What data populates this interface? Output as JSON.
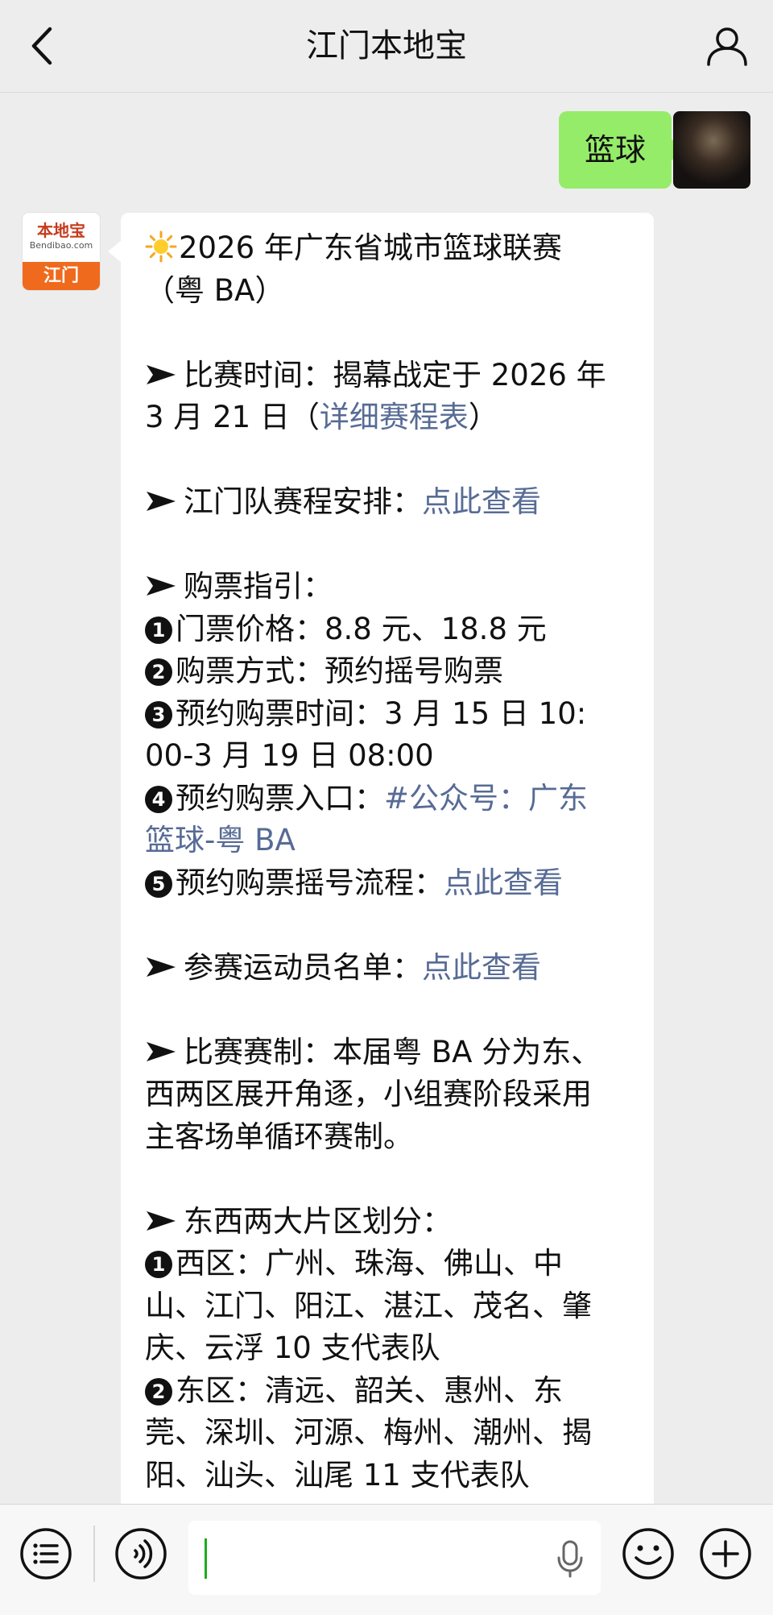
{
  "header": {
    "title": "江门本地宝"
  },
  "chat": {
    "outgoing_text": "篮球",
    "bot_avatar": {
      "brand": "本地宝",
      "site": "Bendibao.com",
      "city": "江门"
    }
  },
  "article": {
    "lines": [
      {
        "type": "text",
        "icon": "sun",
        "segments": [
          {
            "text": "2026 年广东省城市篮球联赛"
          }
        ]
      },
      {
        "type": "text",
        "segments": [
          {
            "text": "（粤 BA）"
          }
        ]
      },
      {
        "type": "blank"
      },
      {
        "type": "text",
        "icon": "arrow",
        "segments": [
          {
            "text": "比赛时间：揭幕战定于 2026 年"
          }
        ]
      },
      {
        "type": "text",
        "segments": [
          {
            "text": "3 月 21 日（"
          },
          {
            "text": "详细赛程表",
            "link": true
          },
          {
            "text": "）"
          }
        ]
      },
      {
        "type": "blank"
      },
      {
        "type": "text",
        "icon": "arrow",
        "segments": [
          {
            "text": "江门队赛程安排："
          },
          {
            "text": "点此查看",
            "link": true
          }
        ]
      },
      {
        "type": "blank"
      },
      {
        "type": "text",
        "icon": "arrow",
        "segments": [
          {
            "text": "购票指引："
          }
        ]
      },
      {
        "type": "text",
        "num": "1",
        "segments": [
          {
            "text": "门票价格：8.8 元、18.8 元"
          }
        ]
      },
      {
        "type": "text",
        "num": "2",
        "segments": [
          {
            "text": "购票方式：预约摇号购票"
          }
        ]
      },
      {
        "type": "text",
        "num": "3",
        "segments": [
          {
            "text": "预约购票时间：3 月 15 日 10:"
          }
        ]
      },
      {
        "type": "text",
        "segments": [
          {
            "text": "00-3 月 19 日 08:00"
          }
        ]
      },
      {
        "type": "text",
        "num": "4",
        "segments": [
          {
            "text": "预约购票入口："
          },
          {
            "text": "#公众号：广东",
            "link": true
          }
        ]
      },
      {
        "type": "text",
        "segments": [
          {
            "text": "篮球-粤 BA",
            "link": true
          }
        ]
      },
      {
        "type": "text",
        "num": "5",
        "segments": [
          {
            "text": "预约购票摇号流程："
          },
          {
            "text": "点此查看",
            "link": true
          }
        ]
      },
      {
        "type": "blank"
      },
      {
        "type": "text",
        "icon": "arrow",
        "segments": [
          {
            "text": "参赛运动员名单："
          },
          {
            "text": "点此查看",
            "link": true
          }
        ]
      },
      {
        "type": "blank"
      },
      {
        "type": "text",
        "icon": "arrow",
        "segments": [
          {
            "text": "比赛赛制：本届粤 BA 分为东、"
          }
        ]
      },
      {
        "type": "text",
        "segments": [
          {
            "text": "西两区展开角逐，小组赛阶段采用"
          }
        ]
      },
      {
        "type": "text",
        "segments": [
          {
            "text": "主客场单循环赛制。"
          }
        ]
      },
      {
        "type": "blank"
      },
      {
        "type": "text",
        "icon": "arrow",
        "segments": [
          {
            "text": "东西两大片区划分："
          }
        ]
      },
      {
        "type": "text",
        "num": "1",
        "segments": [
          {
            "text": "西区：广州、珠海、佛山、中"
          }
        ]
      },
      {
        "type": "text",
        "segments": [
          {
            "text": "山、江门、阳江、湛江、茂名、肇"
          }
        ]
      },
      {
        "type": "text",
        "segments": [
          {
            "text": "庆、云浮 10 支代表队"
          }
        ]
      },
      {
        "type": "text",
        "num": "2",
        "segments": [
          {
            "text": "东区：清远、韶关、惠州、东"
          }
        ]
      },
      {
        "type": "text",
        "segments": [
          {
            "text": "莞、深圳、河源、梅州、潮州、揭"
          }
        ]
      },
      {
        "type": "text",
        "segments": [
          {
            "text": "阳、汕头、汕尾 11 支代表队"
          }
        ]
      }
    ]
  },
  "icons": {
    "back": "chevron-left-icon",
    "profile": "person-icon",
    "menu": "list-icon",
    "voice": "voice-wave-icon",
    "mic": "microphone-icon",
    "emoji": "smiley-icon",
    "plus": "plus-icon"
  },
  "colors": {
    "link": "#576b95",
    "outgoing_bubble": "#95ec69",
    "caret": "#1aad19"
  }
}
